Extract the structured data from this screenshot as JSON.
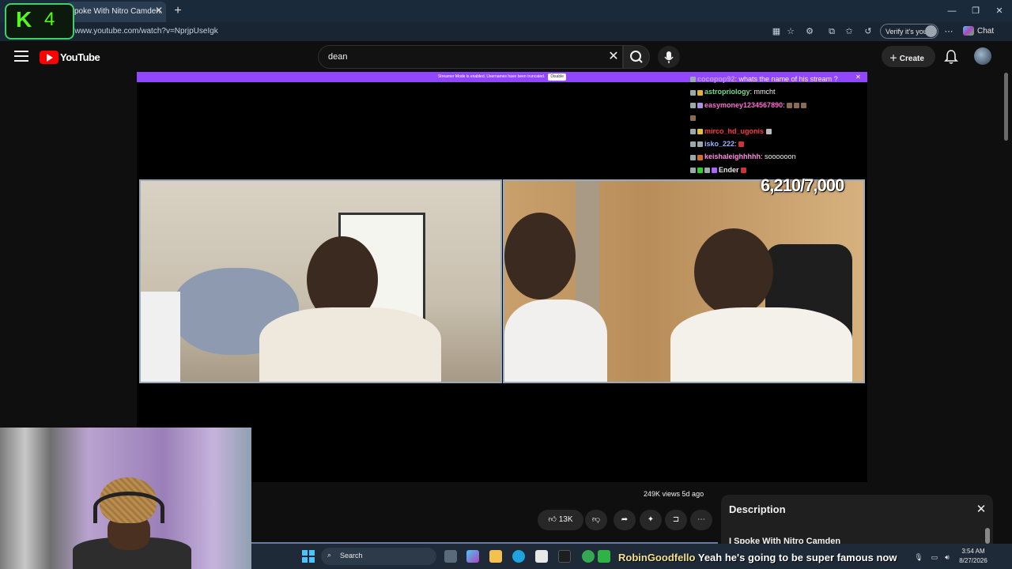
{
  "browser": {
    "tab_title": "I Spoke With Nitro Camden...",
    "tab_title_visible": "poke With Nitro Camden.",
    "url": "://www.youtube.com/watch?v=NprjpUseIgk",
    "verify_label": "Verify it's you",
    "chat_label": "Chat"
  },
  "overlay": {
    "kick_letter": "K",
    "kick_count": "4"
  },
  "youtube": {
    "logo_text": "YouTube",
    "search_value": "dean",
    "create_label": "Create"
  },
  "player": {
    "banner_text": "Streamer Mode is enabled. Usernames have been truncated.",
    "banner_button": "Disable",
    "goal_counter": "6,210/7,000",
    "chat": [
      {
        "user": "cocopop92",
        "color": "#c39bff",
        "msg": "whats the name of his stream ?"
      },
      {
        "user": "astropriology",
        "color": "#7bd88f",
        "msg": "mmcht"
      },
      {
        "user": "easymoney1234567890",
        "color": "#ff6bd6",
        "msg": ""
      },
      {
        "user": "mirco_hd_ugonis",
        "color": "#ff3b3b",
        "msg": ""
      },
      {
        "user": "isko_222",
        "color": "#9ab4ff",
        "msg": ""
      },
      {
        "user": "keishaleighhhhh",
        "color": "#ff8ce0",
        "msg": "soooooon"
      },
      {
        "user": "Ender",
        "color": "#e8e8e8",
        "msg": ""
      }
    ]
  },
  "meta": {
    "views": "249K views",
    "age": "5d ago",
    "likes": "13K"
  },
  "description": {
    "title": "Description",
    "text": "I Spoke With Nitro Camden"
  },
  "taskbar": {
    "search_label": "Search",
    "ticker_user": "RobinGoodfello",
    "ticker_msg": "Yeah he's going to be super famous now",
    "time": "3:54 AM",
    "date": "8/27/2026"
  }
}
